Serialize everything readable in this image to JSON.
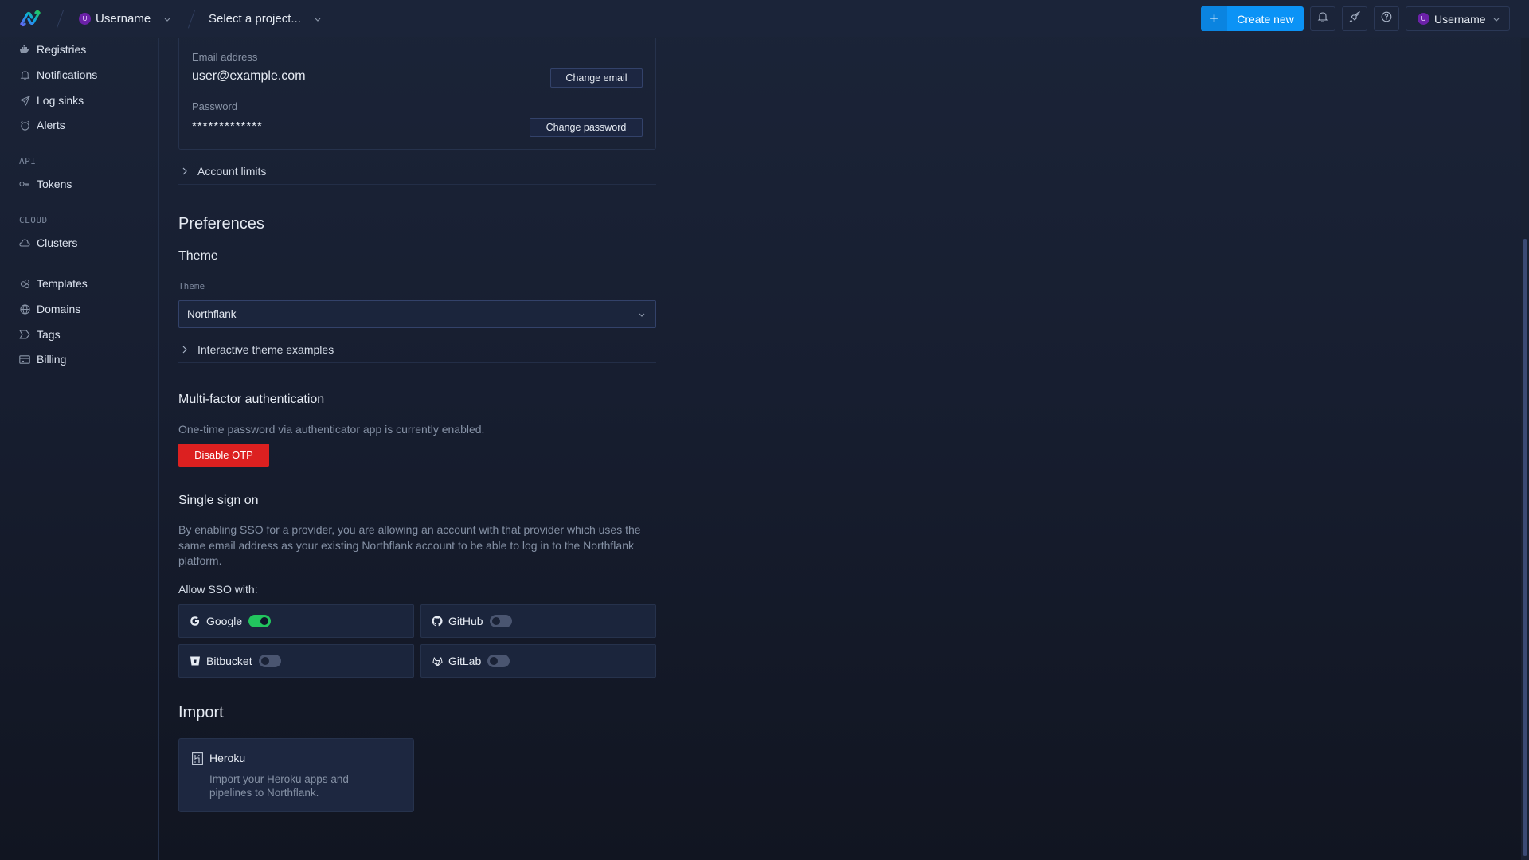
{
  "header": {
    "team": {
      "avatar_initial": "U",
      "label": "Username"
    },
    "project": {
      "label": "Select a project..."
    },
    "create_button": {
      "icon": "plus-icon",
      "label": "Create new"
    },
    "icon_buttons": [
      {
        "icon": "bell-icon",
        "name": "notifications-button"
      },
      {
        "icon": "rocket-icon",
        "name": "deploy-button"
      },
      {
        "icon": "help-icon",
        "name": "help-button"
      }
    ],
    "user_menu": {
      "avatar_initial": "U",
      "label": "Username"
    }
  },
  "sidebar": {
    "items": [
      {
        "label": "Registries",
        "icon": "docker-icon"
      },
      {
        "label": "Notifications",
        "icon": "bell-icon"
      },
      {
        "label": "Log sinks",
        "icon": "send-icon"
      },
      {
        "label": "Alerts",
        "icon": "alarm-icon"
      }
    ],
    "groups": [
      {
        "title": "API",
        "items": [
          {
            "label": "Tokens",
            "icon": "key-icon"
          }
        ]
      },
      {
        "title": "CLOUD",
        "items": [
          {
            "label": "Clusters",
            "icon": "cloud-icon"
          }
        ]
      }
    ],
    "bottom_items": [
      {
        "label": "Templates",
        "icon": "templates-icon"
      },
      {
        "label": "Domains",
        "icon": "globe-icon"
      },
      {
        "label": "Tags",
        "icon": "tag-icon"
      },
      {
        "label": "Billing",
        "icon": "credit-card-icon"
      }
    ]
  },
  "account": {
    "email_label": "Email address",
    "email_value": "user@example.com",
    "change_email": "Change email",
    "password_label": "Password",
    "password_value": "*************",
    "change_password": "Change password",
    "account_limits": "Account limits"
  },
  "preferences": {
    "title": "Preferences",
    "theme_heading": "Theme",
    "theme_label": "Theme",
    "theme_value": "Northflank",
    "theme_examples": "Interactive theme examples"
  },
  "mfa": {
    "title": "Multi-factor authentication",
    "status": "One-time password via authenticator app is currently enabled.",
    "disable_button": "Disable OTP"
  },
  "sso": {
    "title": "Single sign on",
    "description": "By enabling SSO for a provider, you are allowing an account with that provider which uses the same email address as your existing Northflank account to be able to log in to the Northflank platform.",
    "allow_label": "Allow SSO with:",
    "providers": [
      {
        "name": "Google",
        "icon": "google-icon",
        "enabled": true
      },
      {
        "name": "GitHub",
        "icon": "github-icon",
        "enabled": false
      },
      {
        "name": "Bitbucket",
        "icon": "bitbucket-icon",
        "enabled": false
      },
      {
        "name": "GitLab",
        "icon": "gitlab-icon",
        "enabled": false
      }
    ]
  },
  "import": {
    "title": "Import",
    "cards": [
      {
        "name": "Heroku",
        "icon": "heroku-icon",
        "description": "Import your Heroku apps and pipelines to Northflank."
      }
    ]
  },
  "colors": {
    "accent": "#0b93f6",
    "danger": "#dc2020",
    "toggle_on": "#22c55e",
    "avatar": "#6b21a8"
  }
}
